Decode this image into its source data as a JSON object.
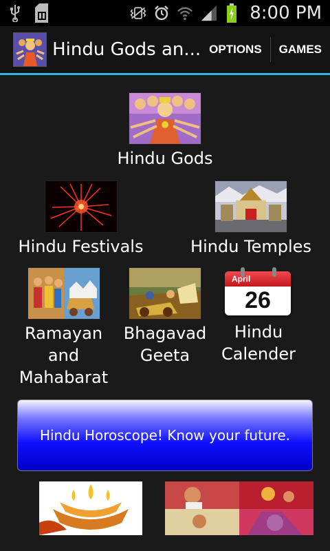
{
  "status_bar": {
    "time": "8:00 PM"
  },
  "action_bar": {
    "title": "Hindu Gods an...",
    "options_label": "OPTIONS",
    "games_label": "GAMES"
  },
  "tiles": {
    "gods": "Hindu Gods",
    "festivals": "Hindu Festivals",
    "temples": "Hindu Temples",
    "ramayan_line1": "Ramayan",
    "ramayan_line2": "and",
    "ramayan_line3": "Mahabarat",
    "geeta_line1": "Bhagavad",
    "geeta_line2": "Geeta",
    "calender_line1": "Hindu",
    "calender_line2": "Calender"
  },
  "calendar_icon": {
    "month": "April",
    "day": "26"
  },
  "banner": {
    "text": "Hindu Horoscope! Know your future."
  },
  "colors": {
    "accent": "#33b5e5",
    "banner_blue": "#1010ff",
    "calendar_red": "#d8232a"
  }
}
